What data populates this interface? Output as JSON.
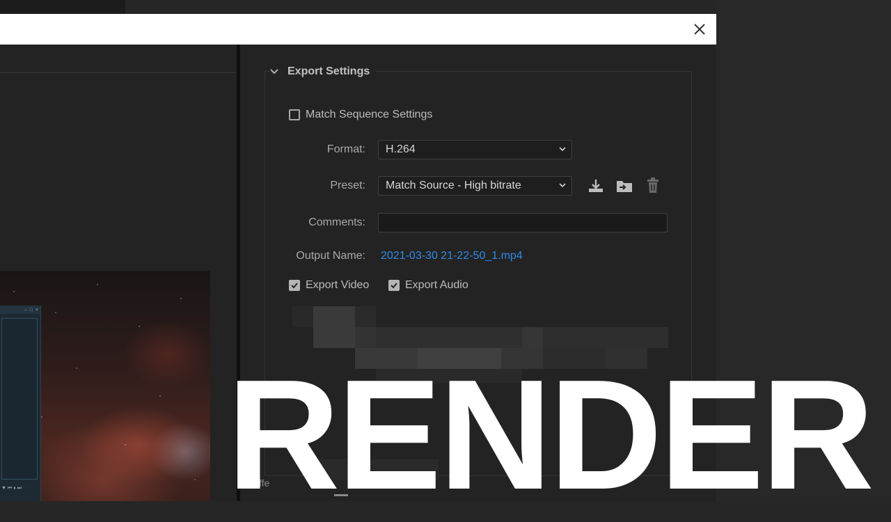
{
  "dialog": {
    "close_icon": "close-icon"
  },
  "export_settings": {
    "title": "Export Settings",
    "match_sequence_label": "Match Sequence Settings",
    "match_sequence_checked": false,
    "format_label": "Format:",
    "format_value": "H.264",
    "preset_label": "Preset:",
    "preset_value": "Match Source - High bitrate",
    "preset_icons": [
      "save-preset-icon",
      "import-preset-icon",
      "delete-preset-icon"
    ],
    "comments_label": "Comments:",
    "comments_value": "",
    "output_name_label": "Output Name:",
    "output_name_value": "2021-03-30 21-22-50_1.mp4",
    "export_video_label": "Export Video",
    "export_video_checked": true,
    "export_audio_label": "Export Audio",
    "export_audio_checked": true,
    "partial_label": "ffe"
  },
  "overlay": {
    "text": "RENDER"
  },
  "colors": {
    "link": "#2f8ae6",
    "background": "#232323",
    "overlay_text": "#ffffff"
  }
}
